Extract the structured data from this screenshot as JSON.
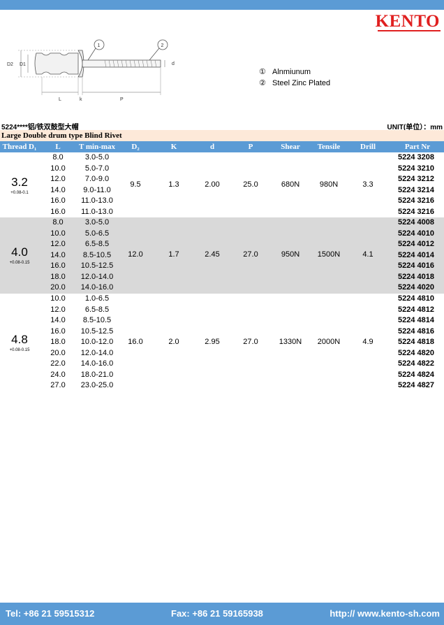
{
  "brand": {
    "logo": "KENTO"
  },
  "diagram_labels": {
    "d2": "D2",
    "d1": "D1",
    "l": "L",
    "k": "k",
    "p": "P",
    "d": "d",
    "callout1": "1",
    "callout2": "2"
  },
  "legend": [
    {
      "num": "①",
      "text": "Alnmiunum"
    },
    {
      "num": "②",
      "text": "Steel Zinc Plated"
    }
  ],
  "product": {
    "code_title": "5224****铝/铁双鼓型大帽",
    "unit": "UNIT(单位）：mm",
    "type": "Large Double drum type Blind Rivet"
  },
  "table": {
    "headers": [
      "Thread D₁",
      "L",
      "T min-max",
      "D₂",
      "K",
      "d",
      "P",
      "Shear",
      "Tensile",
      "Drill",
      "Part Nr"
    ],
    "groups": [
      {
        "thread": "3.2",
        "tolerance": "+0.08-0.1",
        "d2": "9.5",
        "k": "1.3",
        "d": "2.00",
        "p": "25.0",
        "shear": "680N",
        "tensile": "980N",
        "drill": "3.3",
        "rows": [
          {
            "l": "8.0",
            "t": "3.0-5.0",
            "part": "5224 3208"
          },
          {
            "l": "10.0",
            "t": "5.0-7.0",
            "part": "5224 3210"
          },
          {
            "l": "12.0",
            "t": "7.0-9.0",
            "part": "5224 3212"
          },
          {
            "l": "14.0",
            "t": "9.0-11.0",
            "part": "5224 3214"
          },
          {
            "l": "16.0",
            "t": "11.0-13.0",
            "part": "5224 3216"
          },
          {
            "l": "16.0",
            "t": "11.0-13.0",
            "part": "5224 3216"
          }
        ]
      },
      {
        "thread": "4.0",
        "tolerance": "+0.08-0.15",
        "d2": "12.0",
        "k": "1.7",
        "d": "2.45",
        "p": "27.0",
        "shear": "950N",
        "tensile": "1500N",
        "drill": "4.1",
        "rows": [
          {
            "l": "8.0",
            "t": "3.0-5.0",
            "part": "5224 4008"
          },
          {
            "l": "10.0",
            "t": "5.0-6.5",
            "part": "5224 4010"
          },
          {
            "l": "12.0",
            "t": "6.5-8.5",
            "part": "5224 4012"
          },
          {
            "l": "14.0",
            "t": "8.5-10.5",
            "part": "5224 4014"
          },
          {
            "l": "16.0",
            "t": "10.5-12.5",
            "part": "5224 4016"
          },
          {
            "l": "18.0",
            "t": "12.0-14.0",
            "part": "5224 4018"
          },
          {
            "l": "20.0",
            "t": "14.0-16.0",
            "part": "5224 4020"
          }
        ]
      },
      {
        "thread": "4.8",
        "tolerance": "+0.08-0.15",
        "d2": "16.0",
        "k": "2.0",
        "d": "2.95",
        "p": "27.0",
        "shear": "1330N",
        "tensile": "2000N",
        "drill": "4.9",
        "rows": [
          {
            "l": "10.0",
            "t": "1.0-6.5",
            "part": "5224 4810"
          },
          {
            "l": "12.0",
            "t": "6.5-8.5",
            "part": "5224 4812"
          },
          {
            "l": "14.0",
            "t": "8.5-10.5",
            "part": "5224 4814"
          },
          {
            "l": "16.0",
            "t": "10.5-12.5",
            "part": "5224 4816"
          },
          {
            "l": "18.0",
            "t": "10.0-12.0",
            "part": "5224 4818"
          },
          {
            "l": "20.0",
            "t": "12.0-14.0",
            "part": "5224 4820"
          },
          {
            "l": "22.0",
            "t": "14.0-16.0",
            "part": "5224 4822"
          },
          {
            "l": "24.0",
            "t": "18.0-21.0",
            "part": "5224 4824"
          },
          {
            "l": "27.0",
            "t": "23.0-25.0",
            "part": "5224 4827"
          }
        ]
      }
    ]
  },
  "footer": {
    "tel": "Tel: +86 21 59515312",
    "fax": "Fax: +86 21 59165938",
    "web": "http:// www.kento-sh.com"
  }
}
